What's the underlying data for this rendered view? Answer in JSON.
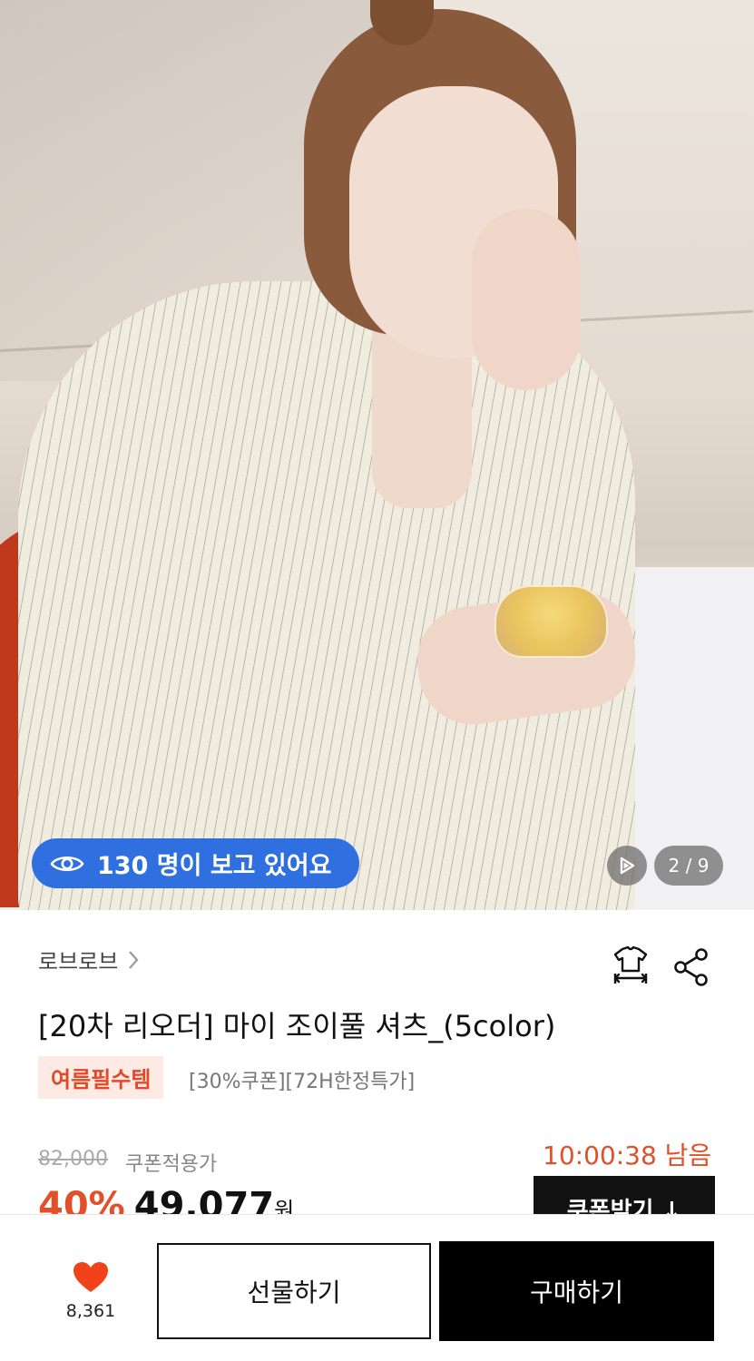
{
  "gallery": {
    "viewers_text": "130 명이 보고 있어요",
    "page_indicator": "2 / 9"
  },
  "product": {
    "brand": "로브로브",
    "title": "[20차 리오더] 마이 조이풀 셔츠_(5color)",
    "tag_label": "여름필수템",
    "promo_text": "[30%쿠폰][72H한정특가]",
    "original_price": "82,000",
    "coupon_label": "쿠폰적용가",
    "countdown": "10:00:38 남음",
    "discount": "40%",
    "sale_price": "49,077",
    "currency": "원",
    "coupon_button": "쿠폰받기 ↓"
  },
  "bottom_bar": {
    "like_count": "8,361",
    "gift_button": "선물하기",
    "buy_button": "구매하기"
  },
  "colors": {
    "accent": "#e2502a",
    "viewers_pill": "#2f6fe0",
    "tag_bg": "#fdeae4",
    "primary_button": "#000000"
  },
  "icons": [
    "eye-icon",
    "play-icon",
    "chevron-right-icon",
    "size-guide-icon",
    "share-icon",
    "heart-icon"
  ]
}
